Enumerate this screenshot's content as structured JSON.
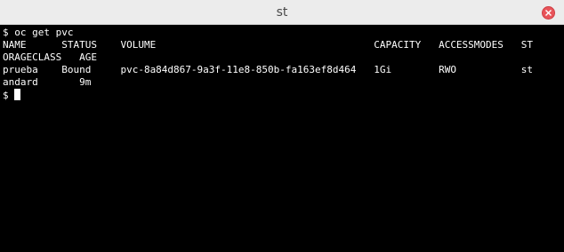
{
  "window": {
    "title": "st"
  },
  "icons": {
    "close": "close-icon",
    "close_color": "#e8545a"
  },
  "terminal": {
    "lines": [
      "$ oc get pvc",
      "NAME      STATUS    VOLUME                                     CAPACITY   ACCESSMODES   ST",
      "ORAGECLASS   AGE",
      "prueba    Bound     pvc-8a84d867-9a3f-11e8-850b-fa163ef8d464   1Gi        RWO           st",
      "andard       9m",
      "$ "
    ],
    "foreground": "#ffffff",
    "background": "#000000"
  }
}
